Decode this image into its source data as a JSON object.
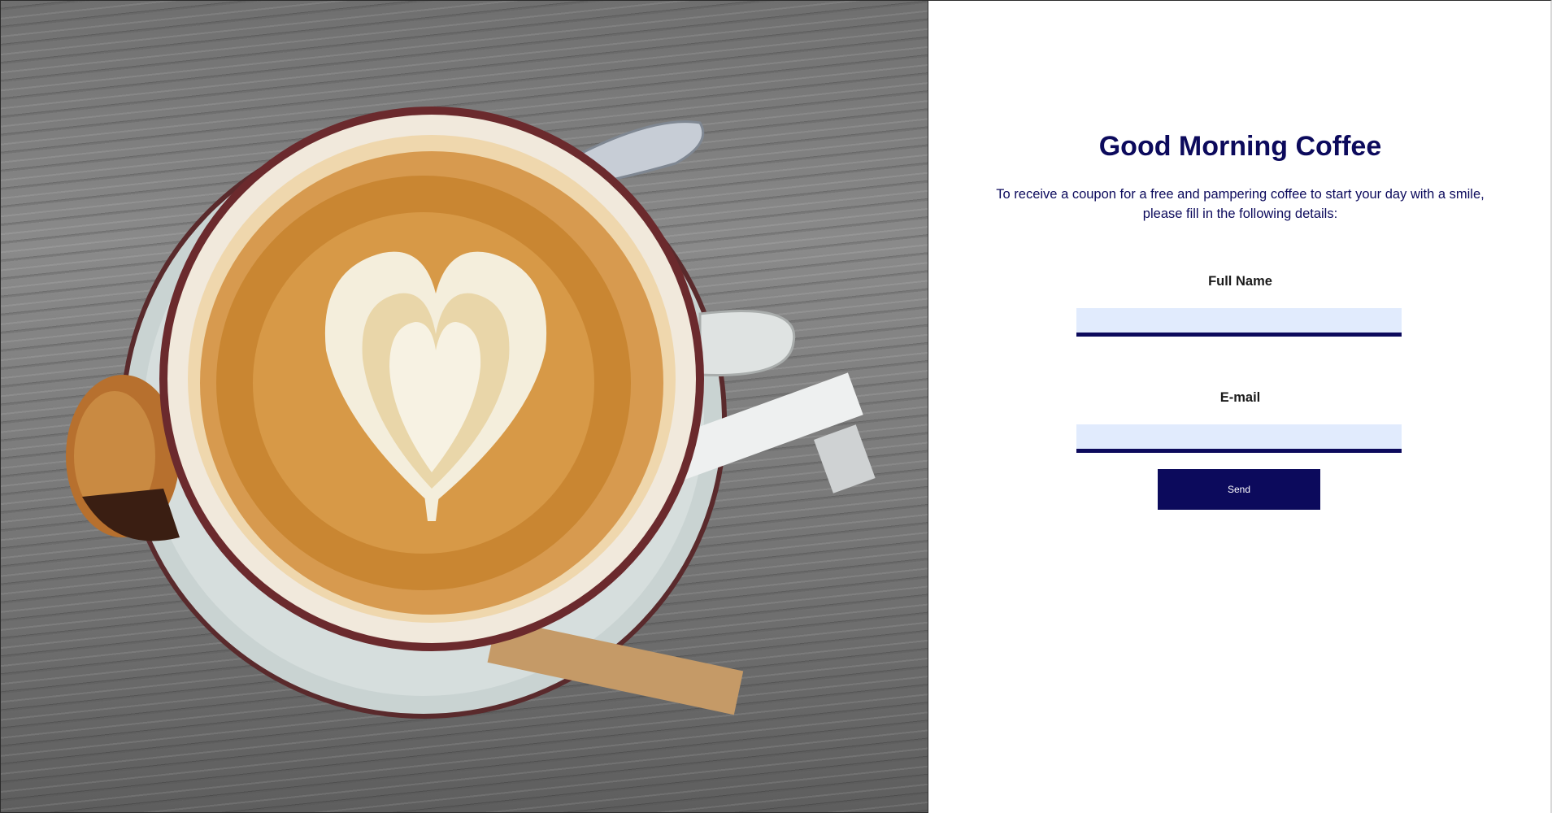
{
  "hero": {
    "image_description_icon": "coffee-latte-art-photo"
  },
  "form": {
    "title": "Good Morning Coffee",
    "intro_line1": "To receive a coupon for a free and pampering coffee to start your day with a smile,",
    "intro_line2": "please fill in the following details:",
    "full_name": {
      "label": "Full Name",
      "value": "",
      "placeholder": ""
    },
    "email": {
      "label": "E-mail",
      "value": "",
      "placeholder": ""
    },
    "send_label": "Send"
  },
  "colors": {
    "primary": "#0c0a5c",
    "input_bg": "#e1ebfd",
    "background": "#ffffff"
  }
}
